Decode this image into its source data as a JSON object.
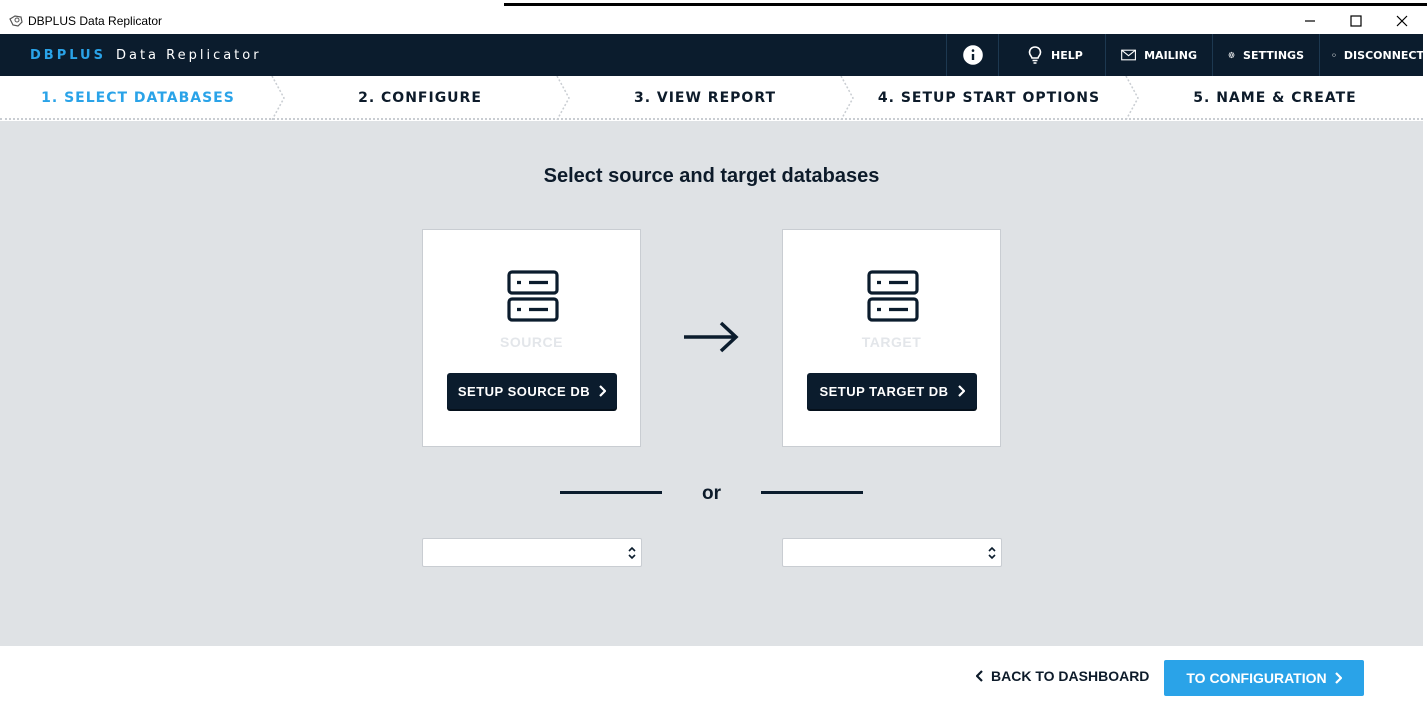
{
  "window": {
    "title": "DBPLUS Data Replicator",
    "controls": [
      "minimize-icon",
      "maximize-icon",
      "close-icon"
    ]
  },
  "header": {
    "brand_primary": "DBPLUS",
    "brand_secondary": "Data Replicator",
    "nav": [
      {
        "icon": "info-icon",
        "label": ""
      },
      {
        "icon": "lightbulb-icon",
        "label": "HELP"
      },
      {
        "icon": "mail-icon",
        "label": "MAILING"
      },
      {
        "icon": "gear-icon",
        "label": "SETTINGS"
      },
      {
        "icon": "power-icon",
        "label": "DISCONNECT"
      }
    ]
  },
  "steps": [
    {
      "label": "1. SELECT DATABASES",
      "active": true
    },
    {
      "label": "2. CONFIGURE",
      "active": false
    },
    {
      "label": "3. VIEW REPORT",
      "active": false
    },
    {
      "label": "4. SETUP START OPTIONS",
      "active": false
    },
    {
      "label": "5. NAME & CREATE",
      "active": false
    }
  ],
  "main": {
    "heading": "Select source and target databases",
    "source": {
      "label": "SOURCE",
      "button": "SETUP SOURCE DB"
    },
    "target": {
      "label": "TARGET",
      "button": "SETUP TARGET DB"
    },
    "or_label": "or",
    "source_select": {
      "value": ""
    },
    "target_select": {
      "value": ""
    }
  },
  "footer": {
    "back_label": "BACK TO DASHBOARD",
    "next_label": "TO CONFIGURATION"
  },
  "colors": {
    "accent": "#2aa3e8",
    "dark": "#0b1c2d",
    "background": "#dfe2e5"
  }
}
